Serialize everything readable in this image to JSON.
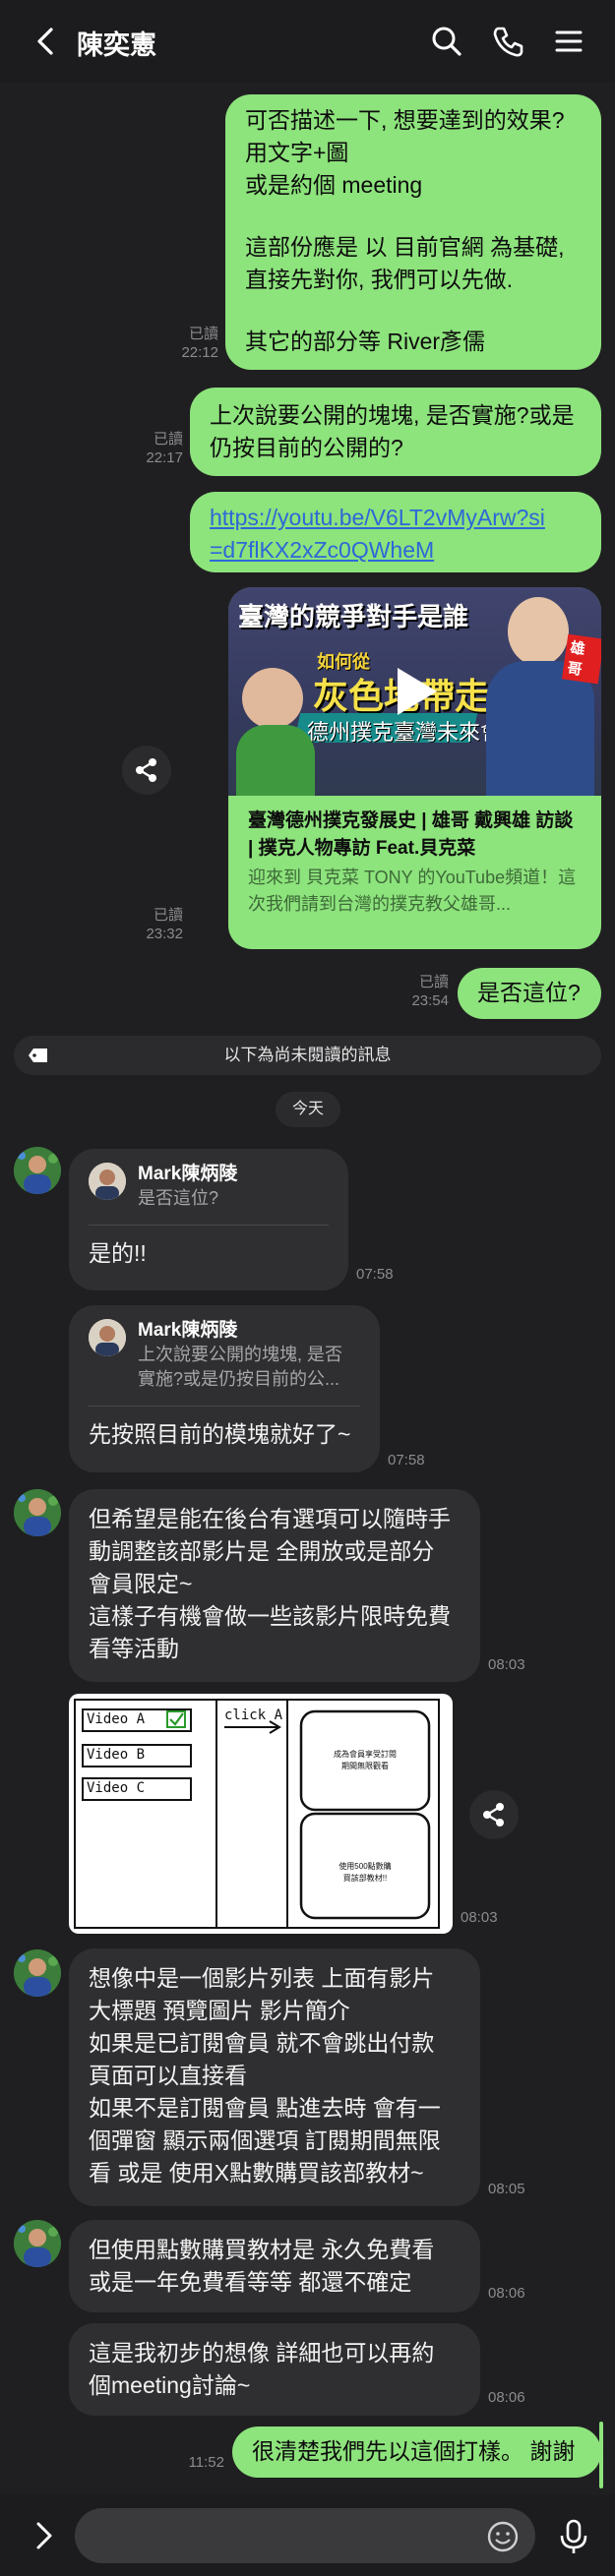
{
  "header": {
    "title": "陳奕憲",
    "icons": [
      "back-icon",
      "search-icon",
      "phone-icon",
      "menu-icon"
    ]
  },
  "messages": {
    "m1": {
      "lines": [
        "可否描述一下, 想要達到的效果?",
        "用文字+圖",
        "或是約個 meeting",
        "",
        "這部份應是 以  目前官網 為基礎,",
        "直接先對你, 我們可以先做.",
        "",
        "其它的部分等 River彥儒"
      ],
      "read": "已讀",
      "time": "22:12"
    },
    "m2": {
      "lines": [
        "上次說要公開的塊塊, 是否實施?或是",
        "仍按目前的公開的?"
      ],
      "read": "已讀",
      "time": "22:17"
    },
    "m3": {
      "link_lines": [
        "https://youtu.be/V6LT2vMyArw?si",
        "=d7flKX2xZc0QWheM"
      ]
    },
    "m4": {
      "thumb_line1": "臺灣的競爭對手是誰",
      "thumb_line2": "如何從",
      "thumb_line3": "灰色地帶走出來",
      "thumb_line4": "德州撲克臺灣未來會怎樣",
      "thumb_badge": "雄哥",
      "title": "臺灣德州撲克發展史 | 雄哥 戴興雄 訪談 | 撲克人物專訪 Feat.貝克菜",
      "desc": "迎來到 貝克菜 TONY 的YouTube頻道！這次我們請到台灣的撲克教父雄哥...",
      "read": "已讀",
      "time": "23:32"
    },
    "m5": {
      "text": "是否這位?",
      "read": "已讀",
      "time": "23:54"
    },
    "unread_sep": "以下為尚未閱讀的訊息",
    "day": "今天",
    "r1": {
      "reply_name": "Mark陳炳陵",
      "reply_text": "是否這位?",
      "text": "是的!!",
      "time": "07:58"
    },
    "r2": {
      "reply_name": "Mark陳炳陵",
      "reply_text_l1": "上次說要公開的塊塊, 是否",
      "reply_text_l2": "實施?或是仍按目前的公...",
      "text": "先按照目前的模塊就好了~",
      "time": "07:58"
    },
    "r3": {
      "lines": [
        "但希望是能在後台有選項可以隨時手",
        "動調整該部影片是 全開放或是部分",
        "會員限定~",
        "這樣子有機會做一些該影片限時免費",
        "看等活動"
      ],
      "time": "08:03"
    },
    "r4": {
      "sketch_items": [
        "Video A",
        "Video B",
        "Video C"
      ],
      "sketch_click": "click A",
      "sketch_box1_l1": "成為會員享受訂閱",
      "sketch_box1_l2": "期間無限觀看",
      "sketch_box2_l1": "使用500點數購",
      "sketch_box2_l2": "買該部教材!!",
      "time": "08:03"
    },
    "r5": {
      "lines": [
        "想像中是一個影片列表 上面有影片",
        "大標題 預覽圖片 影片簡介",
        "如果是已訂閱會員 就不會跳出付款",
        "頁面可以直接看",
        "如果不是訂閱會員 點進去時 會有一",
        "個彈窗 顯示兩個選項 訂閱期間無限",
        "看 或是 使用X點數購買該部教材~"
      ],
      "time": "08:05"
    },
    "r6": {
      "lines": [
        "但使用點數購買教材是 永久免費看",
        "或是一年免費看等等 都還不確定"
      ],
      "time": "08:06"
    },
    "r7": {
      "lines": [
        "這是我初步的想像 詳細也可以再約",
        "個meeting討論~"
      ],
      "time": "08:06"
    },
    "m8": {
      "text": "很清楚我們先以這個打樣。 謝謝",
      "time": "11:52"
    }
  },
  "input": {
    "placeholder": ""
  },
  "colors": {
    "bubble_me": "#8de37c",
    "bubble_them": "#2f2f31",
    "background": "#1f1f21",
    "link": "#2c68d8"
  }
}
